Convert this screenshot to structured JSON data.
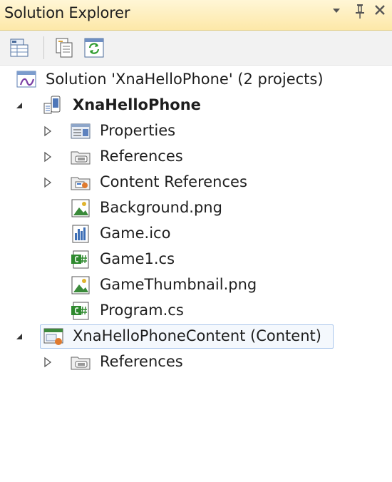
{
  "window": {
    "title": "Solution Explorer",
    "controls": {
      "dropdown": "▼",
      "pin": "📌",
      "close": "×"
    }
  },
  "toolbar": {
    "buttons": [
      {
        "name": "properties-button",
        "icon": "properties-grid-icon"
      },
      {
        "name": "show-all-files-button",
        "icon": "show-all-files-icon"
      },
      {
        "name": "refresh-button",
        "icon": "refresh-icon"
      }
    ]
  },
  "tree": {
    "solution": {
      "label": "Solution 'XnaHelloPhone' (2 projects)",
      "icon": "solution-icon"
    },
    "project1": {
      "label": "XnaHelloPhone",
      "bold": true,
      "expanded": true,
      "icon": "phone-project-icon",
      "items": [
        {
          "label": "Properties",
          "icon": "properties-folder-icon",
          "expandable": true
        },
        {
          "label": "References",
          "icon": "references-folder-icon",
          "expandable": true
        },
        {
          "label": "Content References",
          "icon": "content-references-folder-icon",
          "expandable": true
        },
        {
          "label": "Background.png",
          "icon": "image-file-icon",
          "expandable": false
        },
        {
          "label": "Game.ico",
          "icon": "ico-file-icon",
          "expandable": false
        },
        {
          "label": "Game1.cs",
          "icon": "csharp-file-icon",
          "expandable": false
        },
        {
          "label": "GameThumbnail.png",
          "icon": "image-file-icon",
          "expandable": false
        },
        {
          "label": "Program.cs",
          "icon": "csharp-file-icon",
          "expandable": false
        }
      ]
    },
    "project2": {
      "label": "XnaHelloPhoneContent (Content)",
      "expanded": true,
      "selected": true,
      "icon": "content-project-icon",
      "items": [
        {
          "label": "References",
          "icon": "references-folder-icon",
          "expandable": true
        }
      ]
    }
  },
  "colors": {
    "title_bar_top": "#fff6d6",
    "title_bar_bottom": "#fde8a8",
    "toolbar": "#f2f2f2",
    "selection_border": "#a9c6ec",
    "selection_fill": "#f4f8fd"
  }
}
